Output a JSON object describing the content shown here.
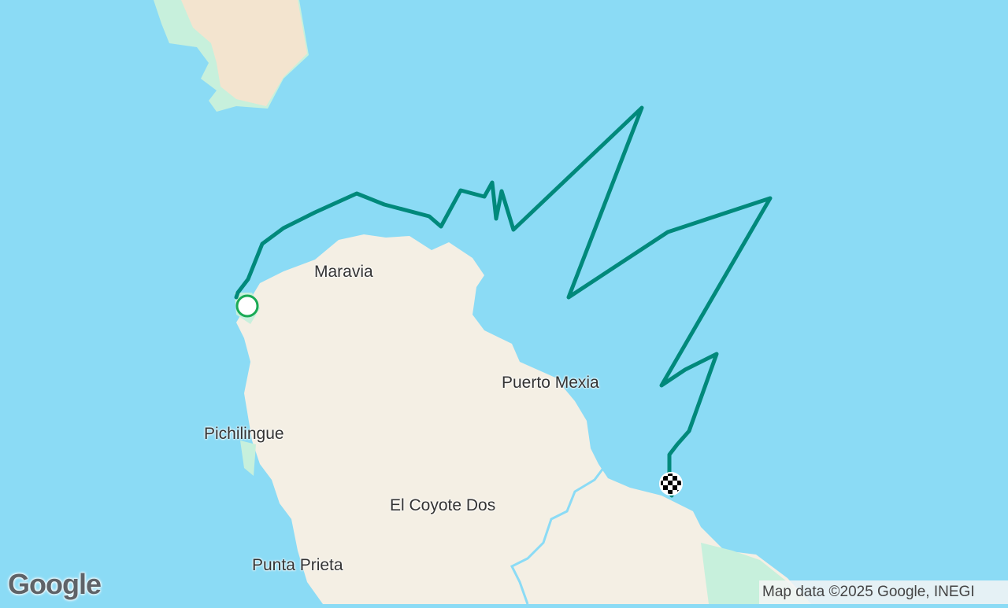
{
  "colors": {
    "water": "#8bdbf5",
    "land": "#f4efe4",
    "land_tan": "#f3e4cf",
    "vegetation": "#c7f0dc",
    "route": "#00897b",
    "start_marker_fill": "#ffffff",
    "start_marker_ring": "#1aaa55"
  },
  "places": [
    {
      "name": "Maravia"
    },
    {
      "name": "Puerto Mexia"
    },
    {
      "name": "Pichilingue"
    },
    {
      "name": "El Coyote Dos"
    },
    {
      "name": "Punta Prieta"
    }
  ],
  "route": {
    "start_icon": "start-circle-icon",
    "end_icon": "checkered-flag-icon"
  },
  "branding": {
    "logo_text": "Google"
  },
  "attribution": {
    "text": "Map data ©2025 Google, INEGI"
  }
}
